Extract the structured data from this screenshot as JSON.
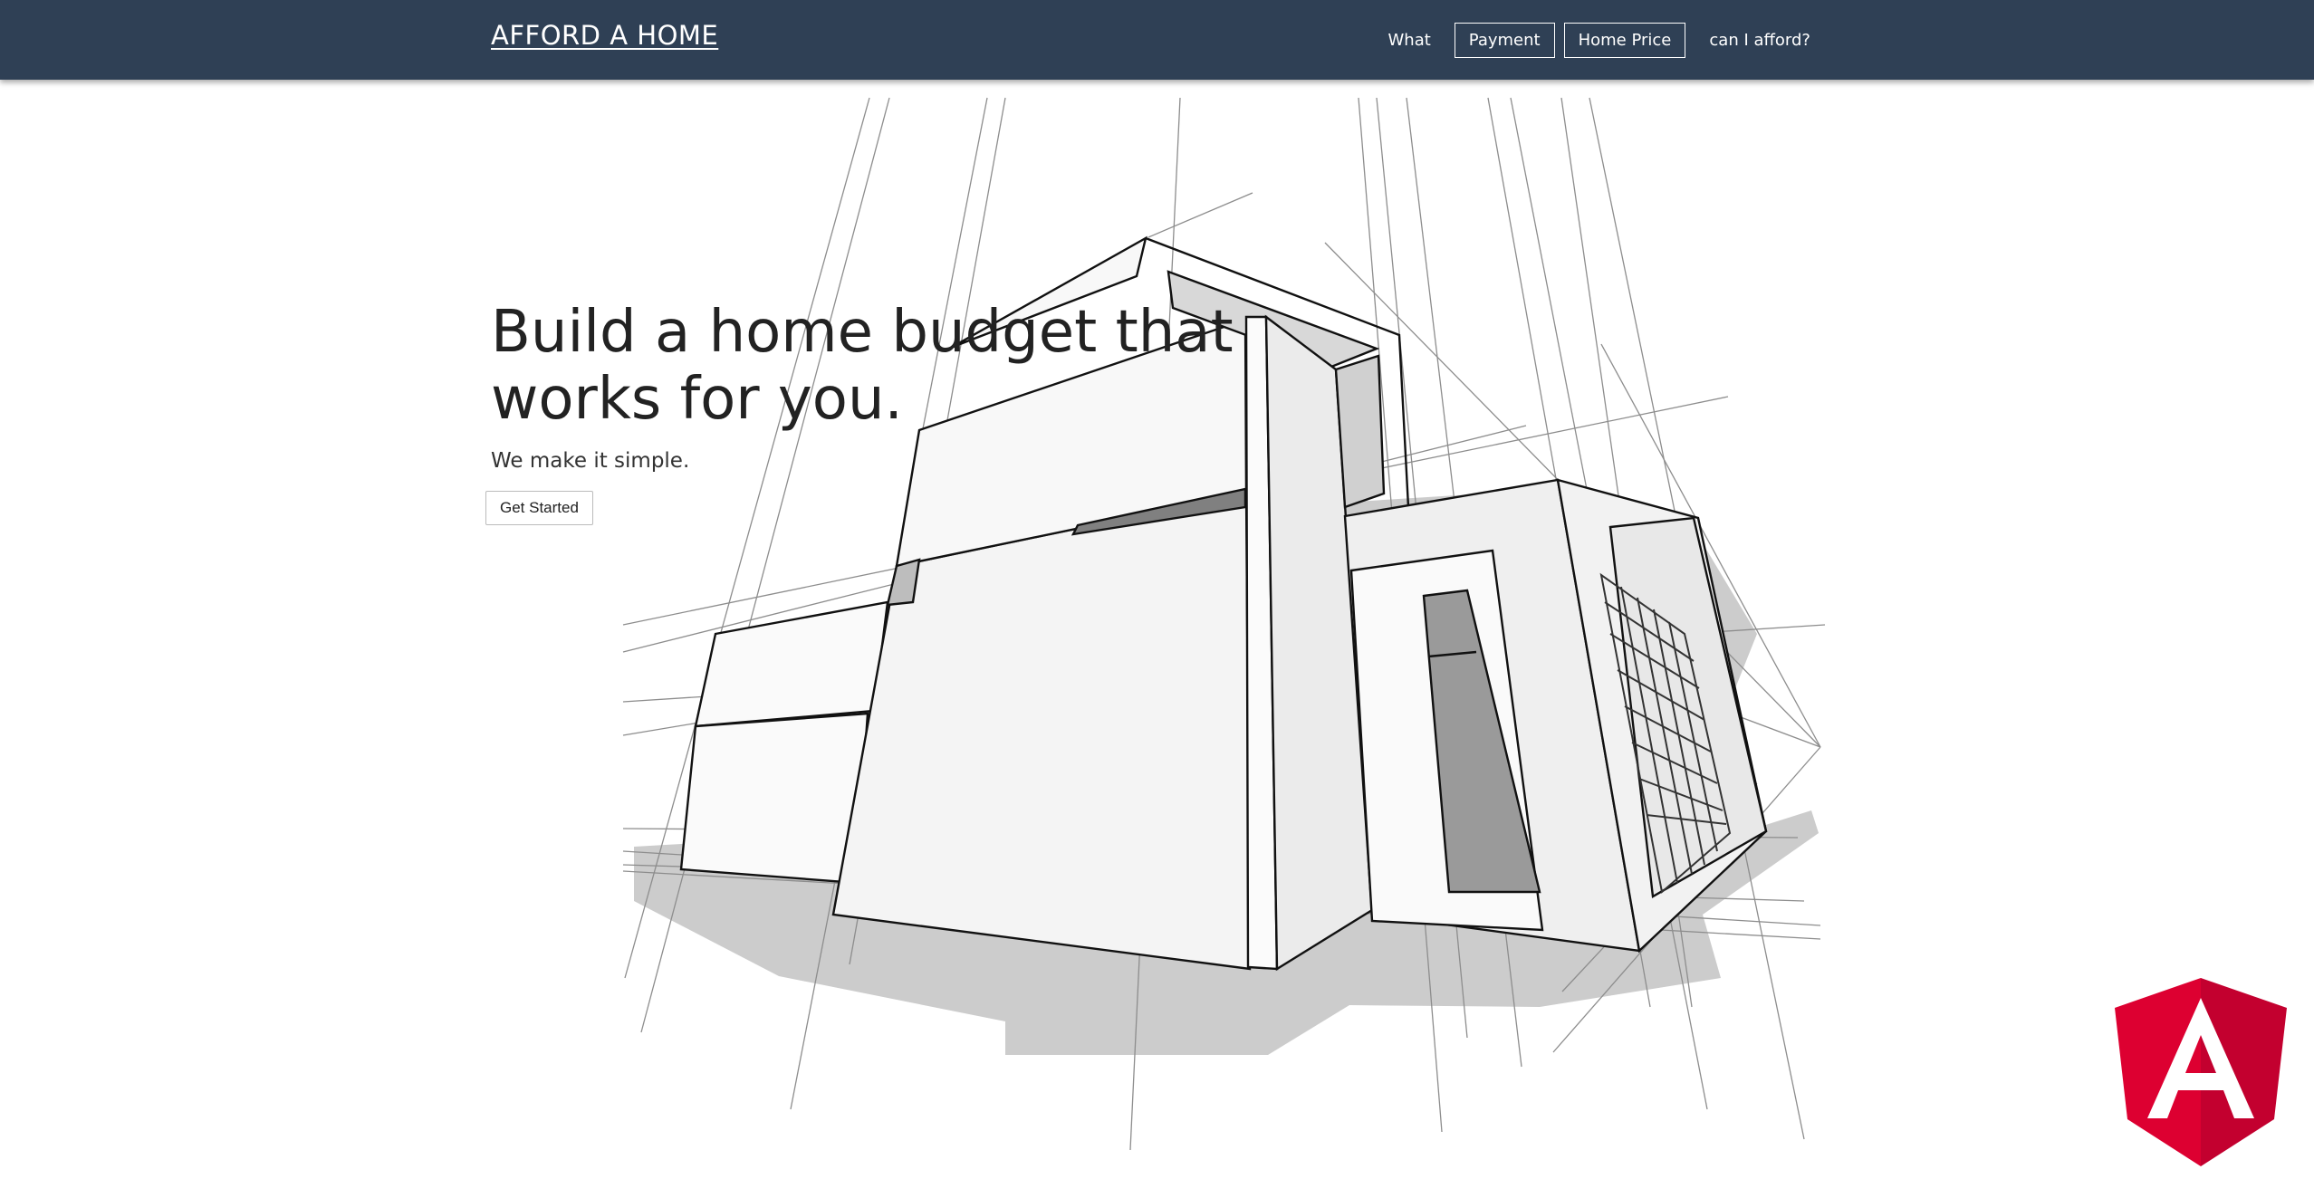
{
  "header": {
    "brand": "AFFORD A HOME",
    "nav": [
      {
        "label": "What",
        "boxed": false
      },
      {
        "label": "Payment",
        "boxed": true
      },
      {
        "label": "Home Price",
        "boxed": true
      },
      {
        "label": "can I afford?",
        "boxed": false
      }
    ]
  },
  "hero": {
    "title_line1": "Build a home budget that",
    "title_line2": "works for you.",
    "subtitle": "We make it simple.",
    "cta_label": "Get Started",
    "illustration": "house-sketch"
  },
  "badge": {
    "icon": "angular-logo-icon",
    "letter": "A",
    "colors": {
      "primary": "#dd0031",
      "secondary": "#c3002f"
    }
  },
  "colors": {
    "navbar": "#2f4055",
    "nav_text": "#ffffff"
  }
}
